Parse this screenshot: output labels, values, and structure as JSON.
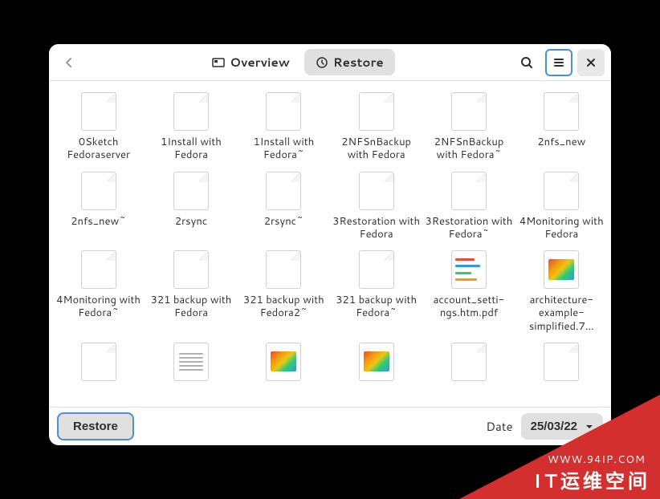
{
  "titlebar": {
    "tabs": [
      {
        "label": "Overview",
        "active": false
      },
      {
        "label": "Restore",
        "active": true
      }
    ]
  },
  "files": [
    {
      "name": "0Sketch Fedoraserver",
      "type": "generic"
    },
    {
      "name": "1Install with Fedora",
      "type": "generic"
    },
    {
      "name": "1Install with Fedora~",
      "type": "generic"
    },
    {
      "name": "2NFSnBackup with Fedora",
      "type": "generic"
    },
    {
      "name": "2NFSnBackup with Fedora~",
      "type": "generic"
    },
    {
      "name": "2nfs_new",
      "type": "generic"
    },
    {
      "name": "2nfs_new~",
      "type": "generic"
    },
    {
      "name": "2rsync",
      "type": "generic"
    },
    {
      "name": "2rsync~",
      "type": "generic"
    },
    {
      "name": "3Restoration with Fedora",
      "type": "generic"
    },
    {
      "name": "3Restoration with Fedora~",
      "type": "generic"
    },
    {
      "name": "4Monitoring with Fedora",
      "type": "generic"
    },
    {
      "name": "4Monitoring with Fedora~",
      "type": "generic"
    },
    {
      "name": "321 backup with Fedora",
      "type": "generic"
    },
    {
      "name": "321 backup with Fedora2~",
      "type": "generic"
    },
    {
      "name": "321 backup with Fedora~",
      "type": "generic"
    },
    {
      "name": "account_setti-ngs.htm.pdf",
      "type": "pdf"
    },
    {
      "name": "architecture-example-simplified.7…",
      "type": "image"
    },
    {
      "name": "",
      "type": "generic"
    },
    {
      "name": "",
      "type": "text"
    },
    {
      "name": "",
      "type": "image"
    },
    {
      "name": "",
      "type": "image"
    },
    {
      "name": "",
      "type": "generic"
    },
    {
      "name": "",
      "type": "generic"
    }
  ],
  "bottombar": {
    "restore_label": "Restore",
    "date_label": "Date",
    "date_value": "25/03/22"
  },
  "watermark": {
    "url": "WWW.94IP.COM",
    "title": "IT运维空间"
  }
}
